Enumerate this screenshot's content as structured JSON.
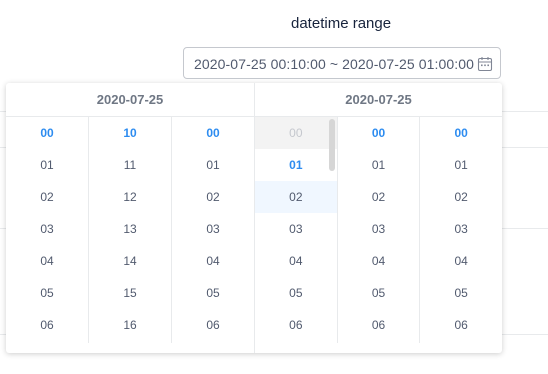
{
  "label": "datetime range",
  "input": {
    "value": "2020-07-25 00:10:00 ~ 2020-07-25 01:00:00"
  },
  "icons": {
    "calendar": "calendar-icon"
  },
  "left": {
    "header": "2020-07-25",
    "hours": {
      "selected": "00",
      "items": [
        "00",
        "01",
        "02",
        "03",
        "04",
        "05",
        "06"
      ]
    },
    "minutes": {
      "selected": "10",
      "items": [
        "10",
        "11",
        "12",
        "13",
        "14",
        "15",
        "16"
      ]
    },
    "seconds": {
      "selected": "00",
      "items": [
        "00",
        "01",
        "02",
        "03",
        "04",
        "05",
        "06"
      ]
    }
  },
  "right": {
    "header": "2020-07-25",
    "hours": {
      "selected": "01",
      "disabled": [
        "00"
      ],
      "hover": "02",
      "items": [
        "00",
        "01",
        "02",
        "03",
        "04",
        "05",
        "06"
      ]
    },
    "minutes": {
      "selected": "00",
      "items": [
        "00",
        "01",
        "02",
        "03",
        "04",
        "05",
        "06"
      ]
    },
    "seconds": {
      "selected": "00",
      "items": [
        "00",
        "01",
        "02",
        "03",
        "04",
        "05",
        "06"
      ]
    }
  },
  "colors": {
    "accent": "#2d8cf0",
    "disabled": "#c5c8ce",
    "hover_bg": "#f0f7ff",
    "border": "#e8eaec"
  }
}
